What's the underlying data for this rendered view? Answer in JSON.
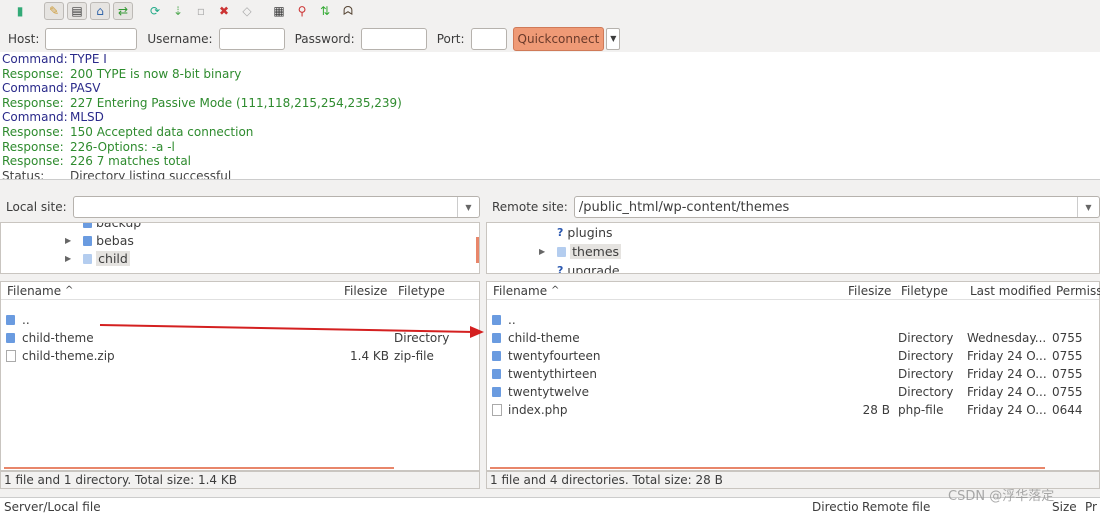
{
  "toolbar": {
    "icons": [
      "site-manager-icon",
      "message-log-icon",
      "local-tree-icon",
      "remote-tree-icon",
      "transfer-queue-icon",
      "refresh-icon",
      "process-queue-icon",
      "cancel-icon",
      "disconnect-icon",
      "reconnect-icon",
      "filter-icon",
      "compare-icon",
      "sync-browse-icon",
      "search-icon"
    ]
  },
  "quickconnect": {
    "host_label": "Host:",
    "host_value": "",
    "username_label": "Username:",
    "username_value": "",
    "password_label": "Password:",
    "password_value": "",
    "port_label": "Port:",
    "port_value": "",
    "button": "Quickconnect"
  },
  "log": [
    {
      "kind": "cmd",
      "label": "Command:",
      "text": "TYPE I"
    },
    {
      "kind": "resp",
      "label": "Response:",
      "text": "200 TYPE is now 8-bit binary"
    },
    {
      "kind": "cmd",
      "label": "Command:",
      "text": "PASV"
    },
    {
      "kind": "resp",
      "label": "Response:",
      "text": "227 Entering Passive Mode (111,118,215,254,235,239)"
    },
    {
      "kind": "cmd",
      "label": "Command:",
      "text": "MLSD"
    },
    {
      "kind": "resp",
      "label": "Response:",
      "text": "150 Accepted data connection"
    },
    {
      "kind": "resp",
      "label": "Response:",
      "text": "226-Options: -a -l"
    },
    {
      "kind": "resp",
      "label": "Response:",
      "text": "226 7 matches total"
    },
    {
      "kind": "stat",
      "label": "Status:",
      "text": "Directory listing successful"
    }
  ],
  "local": {
    "site_label": "Local site:",
    "site_value": "",
    "tree": [
      "backup",
      "bebas",
      "child"
    ],
    "columns": [
      "Filename",
      "Filesize",
      "Filetype"
    ],
    "files": [
      {
        "name": "..",
        "size": "",
        "type": ""
      },
      {
        "name": "child-theme",
        "size": "",
        "type": "Directory"
      },
      {
        "name": "child-theme.zip",
        "size": "1.4 KB",
        "type": "zip-file"
      }
    ],
    "status": "1 file and 1 directory. Total size: 1.4 KB"
  },
  "remote": {
    "site_label": "Remote site:",
    "site_value": "/public_html/wp-content/themes",
    "tree": [
      "plugins",
      "themes",
      "upgrade"
    ],
    "columns": [
      "Filename",
      "Filesize",
      "Filetype",
      "Last modified",
      "Permiss"
    ],
    "files": [
      {
        "name": "..",
        "size": "",
        "type": "",
        "modified": "",
        "perm": ""
      },
      {
        "name": "child-theme",
        "size": "",
        "type": "Directory",
        "modified": "Wednesday...",
        "perm": "0755"
      },
      {
        "name": "twentyfourteen",
        "size": "",
        "type": "Directory",
        "modified": "Friday 24 O...",
        "perm": "0755"
      },
      {
        "name": "twentythirteen",
        "size": "",
        "type": "Directory",
        "modified": "Friday 24 O...",
        "perm": "0755"
      },
      {
        "name": "twentytwelve",
        "size": "",
        "type": "Directory",
        "modified": "Friday 24 O...",
        "perm": "0755"
      },
      {
        "name": "index.php",
        "size": "28 B",
        "type": "php-file",
        "modified": "Friday 24 O...",
        "perm": "0644"
      }
    ],
    "status": "1 file and 4 directories. Total size: 28 B"
  },
  "queue": {
    "columns": [
      "Server/Local file",
      "Directio",
      "Remote file",
      "Size",
      "Pr"
    ]
  },
  "watermark": "CSDN @浮华落定",
  "colors": {
    "accent": "#ef9a76",
    "arrow": "#d42020",
    "command": "#2a2a8a",
    "response": "#2e8b2e"
  }
}
